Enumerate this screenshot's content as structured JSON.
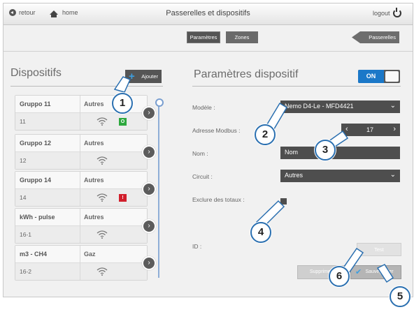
{
  "header": {
    "back_label": "retour",
    "home_label": "home",
    "title": "Passerelles et dispositifs",
    "logout_label": "logout"
  },
  "tabs": [
    {
      "label": "Paramètres",
      "active": true
    },
    {
      "label": "Zones",
      "active": false
    }
  ],
  "passerelles_label": "Passerelles",
  "left_panel": {
    "title": "Dispositifs",
    "add_label": "Ajouter",
    "devices": [
      {
        "name": "Gruppo 11",
        "category": "Autres",
        "number": "11",
        "badge": "O",
        "badge_color": "#2da83e"
      },
      {
        "name": "Gruppo 12",
        "category": "Autres",
        "number": "12",
        "badge": "",
        "badge_color": ""
      },
      {
        "name": "Gruppo 14",
        "category": "Autres",
        "number": "14",
        "badge": "!",
        "badge_color": "#d11f2c"
      },
      {
        "name": "kWh - pulse",
        "category": "Autres",
        "number": "16-1",
        "badge": "",
        "badge_color": ""
      },
      {
        "name": "m3 - CH4",
        "category": "Gaz",
        "number": "16-2",
        "badge": "",
        "badge_color": ""
      }
    ]
  },
  "right_panel": {
    "title": "Paramètres dispositif",
    "toggle_label": "ON",
    "modele_label": "Modèle :",
    "modele_value": "Nemo D4-Le - MFD4421",
    "modbus_label": "Adresse Modbus :",
    "modbus_value": "17",
    "nom_label": "Nom :",
    "nom_placeholder": "Nom",
    "circuit_label": "Circuit :",
    "circuit_value": "Autres",
    "exclure_label": "Exclure des totaux :",
    "id_label": "ID :",
    "test_label": "Test",
    "supprimer_label": "Supprimer",
    "sauvegarder_label": "Sauvegarder"
  },
  "callouts": [
    "1",
    "2",
    "3",
    "4",
    "5",
    "6"
  ],
  "colors": {
    "accent": "#1b78c8",
    "dark_field": "#4e4e4e",
    "callout_border": "#2a6fb0"
  }
}
